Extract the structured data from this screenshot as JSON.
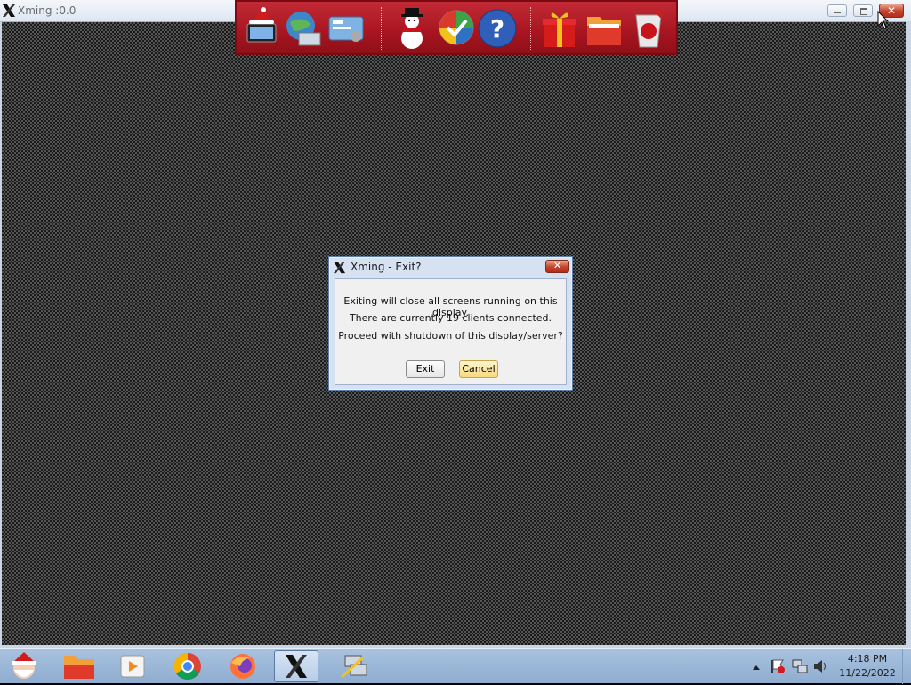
{
  "window": {
    "title": "Xming :0.0",
    "controls": {
      "minimize": "minimize",
      "maximize": "maximize",
      "close": "✕"
    }
  },
  "dock": {
    "icons": [
      "computer-santa-hat-icon",
      "globe-network-icon",
      "control-panel-icon",
      "snowman-icon",
      "windows-update-shield-icon",
      "help-icon",
      "gift-box-icon",
      "folder-icon",
      "recycle-bin-icon"
    ]
  },
  "dialog": {
    "title": "Xming - Exit?",
    "close_label": "✕",
    "lines": [
      "Exiting will close all screens running on this display.",
      "There are currently 19 clients connected.",
      "Proceed with shutdown of this display/server?"
    ],
    "exit_label": "Exit",
    "cancel_label": "Cancel"
  },
  "taskbar": {
    "items": [
      "start-santa-icon",
      "folder-icon",
      "media-player-icon",
      "chrome-icon",
      "firefox-icon",
      "xming-icon",
      "network-putty-icon"
    ],
    "clock": {
      "time": "4:18 PM",
      "date": "11/22/2022"
    }
  },
  "colors": {
    "dock_red": "#b01c26",
    "dialog_frame": "#d6e2f1",
    "taskbar": "#9db8d8"
  }
}
